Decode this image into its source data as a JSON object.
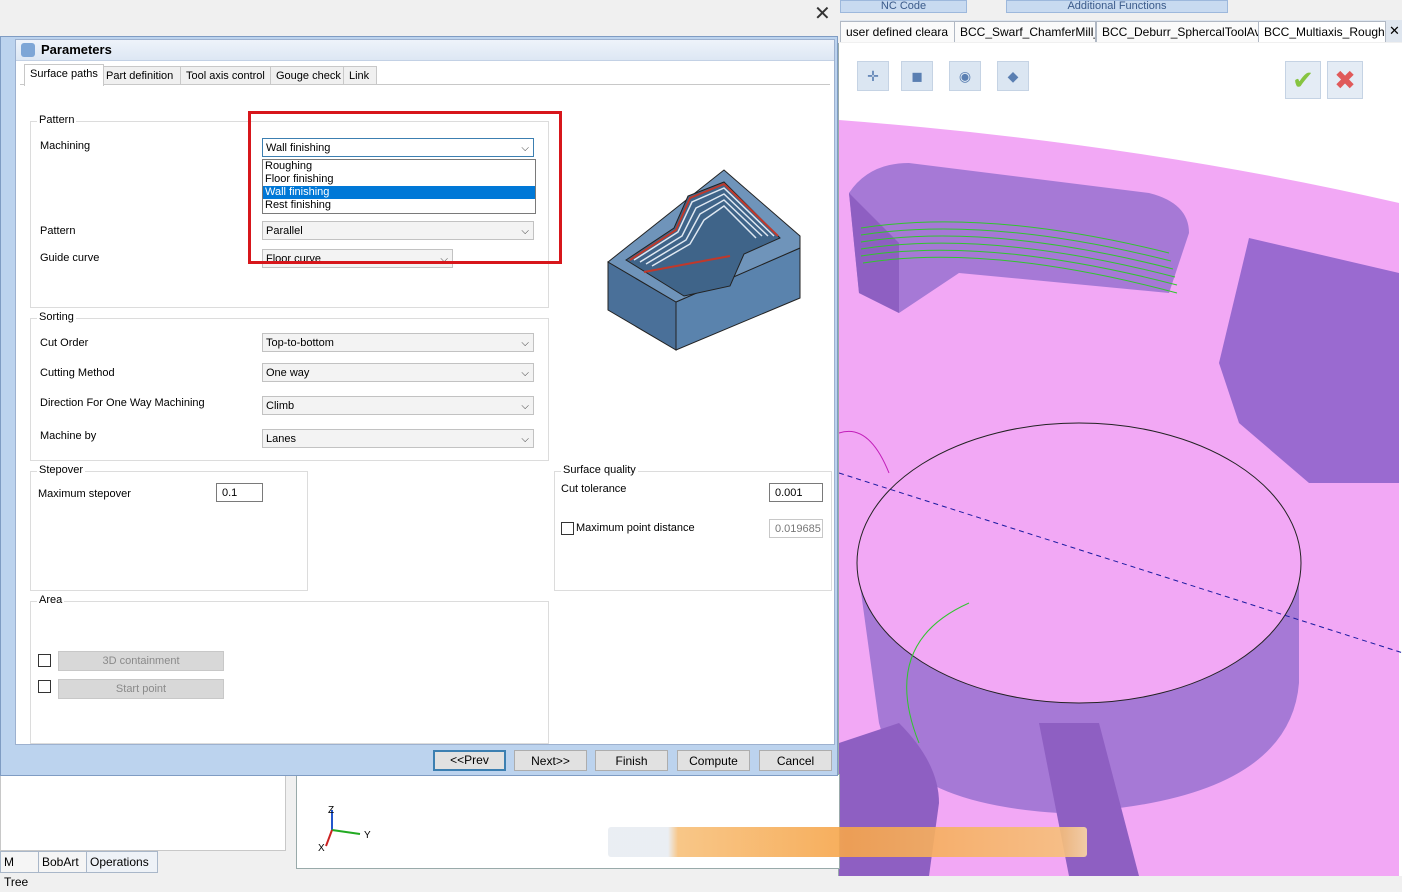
{
  "ribbon": {
    "tab_nc_code": "NC Code",
    "tab_additional": "Additional Functions"
  },
  "doc_tabs": [
    "user defined cleara",
    "BCC_Swarf_ChamferMill_(",
    "BCC_Deburr_SphercalToolAvc",
    "BCC_Multiaxis_Rough"
  ],
  "dialog": {
    "title": "Parameters",
    "tabs": [
      "Surface paths",
      "Part definition",
      "Tool axis control",
      "Gouge check",
      "Link"
    ],
    "pattern_group": {
      "title": "Pattern",
      "machining_label": "Machining",
      "machining_value": "Wall finishing",
      "machining_options": [
        "Roughing",
        "Floor finishing",
        "Wall finishing",
        "Rest finishing"
      ],
      "pattern_label": "Pattern",
      "pattern_value": "Parallel",
      "guide_label": "Guide curve",
      "guide_value": "Floor curve"
    },
    "sorting_group": {
      "title": "Sorting",
      "cut_order_label": "Cut Order",
      "cut_order_value": "Top-to-bottom",
      "cutting_method_label": "Cutting Method",
      "cutting_method_value": "One way",
      "direction_label": "Direction For One Way Machining",
      "direction_value": "Climb",
      "machine_by_label": "Machine by",
      "machine_by_value": "Lanes"
    },
    "stepover_group": {
      "title": "Stepover",
      "max_label": "Maximum stepover",
      "max_value": "0.1"
    },
    "quality_group": {
      "title": "Surface quality",
      "tol_label": "Cut tolerance",
      "tol_value": "0.001",
      "max_point_label": "Maximum point distance",
      "max_point_value": "0.019685"
    },
    "area_group": {
      "title": "Area",
      "containment_label": "3D containment",
      "start_point_label": "Start point"
    },
    "buttons": {
      "prev": "<<Prev",
      "next": "Next>>",
      "finish": "Finish",
      "compute": "Compute",
      "cancel": "Cancel"
    }
  },
  "bottom_tabs": [
    "M Tree",
    "BobArt",
    "Operations"
  ],
  "axes": {
    "z": "Z",
    "y": "Y",
    "x": "X"
  },
  "colors": {
    "highlight": "#d7161b",
    "part": "#f2a8f5",
    "wall": "#a679d6",
    "selection": "#0078d7"
  }
}
